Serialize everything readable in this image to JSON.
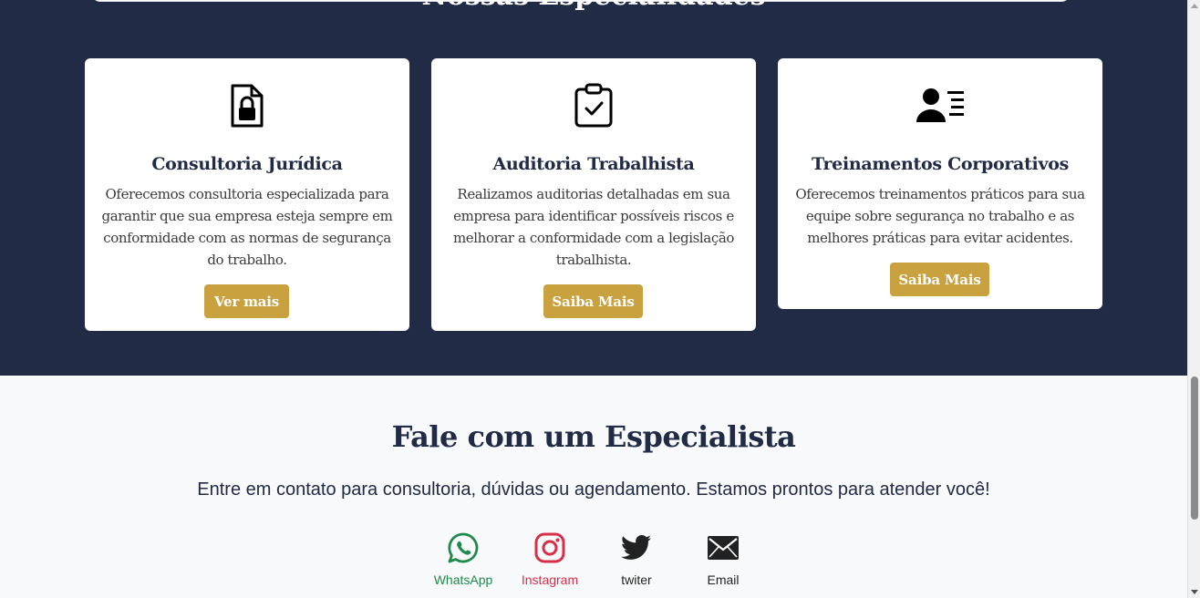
{
  "specialties": {
    "section_title": "Nossas Especialidades",
    "cards": [
      {
        "icon": "lock-document-icon",
        "title": "Consultoria Jurídica",
        "description": "Oferecemos consultoria especializada para garantir que sua empresa esteja sempre em conformidade com as normas de segurança do trabalho.",
        "button": "Ver mais"
      },
      {
        "icon": "clipboard-check-icon",
        "title": "Auditoria Trabalhista",
        "description": "Realizamos auditorias detalhadas em sua empresa para identificar possíveis riscos e melhorar a conformidade com a legislação trabalhista.",
        "button": "Saiba Mais"
      },
      {
        "icon": "user-list-icon",
        "title": "Treinamentos Corporativos",
        "description": "Oferecemos treinamentos práticos para sua equipe sobre segurança no trabalho e as melhores práticas para evitar acidentes.",
        "button": "Saiba Mais"
      }
    ]
  },
  "contact": {
    "title": "Fale com um Especialista",
    "text": "Entre em contato para consultoria, dúvidas ou agendamento. Estamos prontos para atender você!",
    "links": [
      {
        "label": "WhatsApp",
        "icon": "whatsapp-icon",
        "color": "#1f8a4c"
      },
      {
        "label": "Instagram",
        "icon": "instagram-icon",
        "color": "#d62f4a"
      },
      {
        "label": "twiter",
        "icon": "twitter-icon",
        "color": "#222222"
      },
      {
        "label": "Email",
        "icon": "email-icon",
        "color": "#222222"
      }
    ]
  },
  "colors": {
    "navy": "#212b46",
    "gold": "#c9a23f",
    "background": "#f8f9fa"
  }
}
